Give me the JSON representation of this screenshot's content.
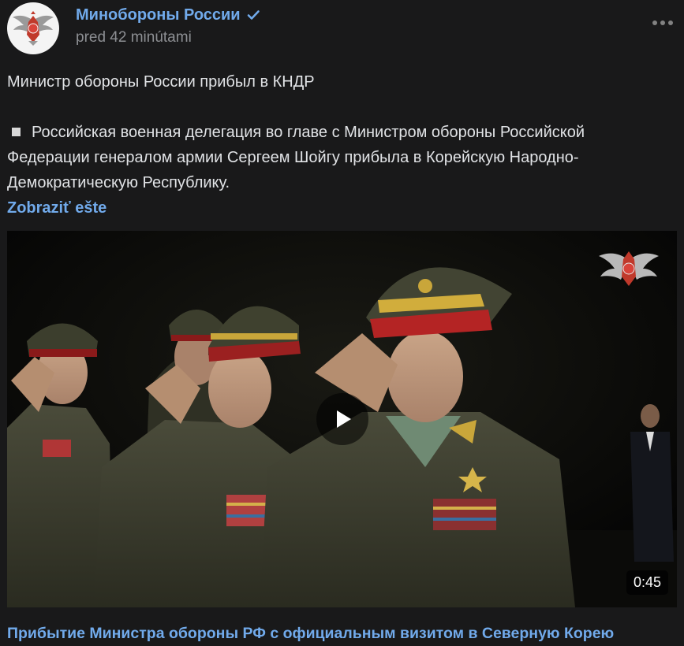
{
  "post": {
    "author": "Минобороны России",
    "time": "pred 42 minútami",
    "title_line": "Министр обороны России прибыл в КНДР",
    "body": "Российская военная делегация во главе с Министром обороны Российской Федерации генералом армии Сергеем Шойгу прибыла в Корейскую Народно-Демократическую Республику.",
    "show_more": "Zobraziť ešte"
  },
  "video": {
    "duration": "0:45",
    "caption": "Прибытие Министра обороны РФ с официальным визитом в Северную Корею"
  },
  "colors": {
    "background": "#19191a",
    "link": "#71aaeb",
    "text": "#e1e3e6",
    "muted": "#8d8f93"
  },
  "icons": [
    "ministry-emblem-icon",
    "verified-check-icon",
    "more-dots-icon",
    "play-icon",
    "watermark-emblem-icon"
  ]
}
